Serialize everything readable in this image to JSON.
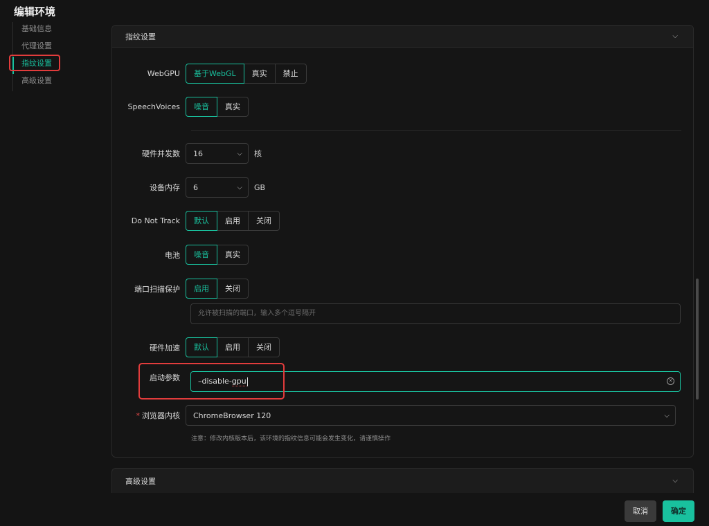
{
  "page_title": "编辑环境",
  "nav": [
    {
      "label": "基础信息",
      "active": false
    },
    {
      "label": "代理设置",
      "active": false
    },
    {
      "label": "指纹设置",
      "active": true
    },
    {
      "label": "高级设置",
      "active": false
    }
  ],
  "section": {
    "title": "指纹设置",
    "webgpu": {
      "label": "WebGPU",
      "options": [
        "基于WebGL",
        "真实",
        "禁止"
      ],
      "selected": "基于WebGL"
    },
    "speech": {
      "label": "SpeechVoices",
      "options": [
        "噪音",
        "真实"
      ],
      "selected": "噪音"
    },
    "concurrency": {
      "label": "硬件并发数",
      "value": "16",
      "unit": "核"
    },
    "memory": {
      "label": "设备内存",
      "value": "6",
      "unit": "GB"
    },
    "dnt": {
      "label": "Do Not Track",
      "options": [
        "默认",
        "启用",
        "关闭"
      ],
      "selected": "默认"
    },
    "battery": {
      "label": "电池",
      "options": [
        "噪音",
        "真实"
      ],
      "selected": "噪音"
    },
    "port_scan": {
      "label": "端口扫描保护",
      "options": [
        "启用",
        "关闭"
      ],
      "selected": "启用",
      "placeholder": "允许被扫描的端口，输入多个逗号隔开"
    },
    "hw_accel": {
      "label": "硬件加速",
      "options": [
        "默认",
        "启用",
        "关闭"
      ],
      "selected": "默认"
    },
    "launch_args": {
      "label": "启动参数",
      "value_prefix": "–disable-",
      "value_tail": "gpu"
    },
    "kernel": {
      "label": "浏览器内核",
      "required_mark": "*",
      "value": "ChromeBrowser 120",
      "note": "注意：修改内核版本后，该环境的指纹信息可能会发生变化，请谨慎操作"
    }
  },
  "advanced_section": {
    "title": "高级设置"
  },
  "footer": {
    "cancel": "取消",
    "ok": "确定"
  },
  "colors": {
    "accent": "#19c19e",
    "highlight": "#e23c3c",
    "background": "#141414"
  }
}
